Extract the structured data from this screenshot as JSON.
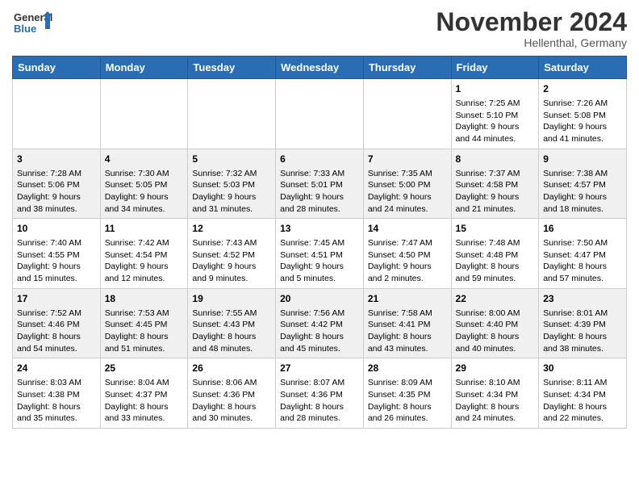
{
  "header": {
    "logo_general": "General",
    "logo_blue": "Blue",
    "month_title": "November 2024",
    "location": "Hellenthal, Germany"
  },
  "weekdays": [
    "Sunday",
    "Monday",
    "Tuesday",
    "Wednesday",
    "Thursday",
    "Friday",
    "Saturday"
  ],
  "weeks": [
    [
      {
        "day": "",
        "sunrise": "",
        "sunset": "",
        "daylight": ""
      },
      {
        "day": "",
        "sunrise": "",
        "sunset": "",
        "daylight": ""
      },
      {
        "day": "",
        "sunrise": "",
        "sunset": "",
        "daylight": ""
      },
      {
        "day": "",
        "sunrise": "",
        "sunset": "",
        "daylight": ""
      },
      {
        "day": "",
        "sunrise": "",
        "sunset": "",
        "daylight": ""
      },
      {
        "day": "1",
        "sunrise": "Sunrise: 7:25 AM",
        "sunset": "Sunset: 5:10 PM",
        "daylight": "Daylight: 9 hours and 44 minutes."
      },
      {
        "day": "2",
        "sunrise": "Sunrise: 7:26 AM",
        "sunset": "Sunset: 5:08 PM",
        "daylight": "Daylight: 9 hours and 41 minutes."
      }
    ],
    [
      {
        "day": "3",
        "sunrise": "Sunrise: 7:28 AM",
        "sunset": "Sunset: 5:06 PM",
        "daylight": "Daylight: 9 hours and 38 minutes."
      },
      {
        "day": "4",
        "sunrise": "Sunrise: 7:30 AM",
        "sunset": "Sunset: 5:05 PM",
        "daylight": "Daylight: 9 hours and 34 minutes."
      },
      {
        "day": "5",
        "sunrise": "Sunrise: 7:32 AM",
        "sunset": "Sunset: 5:03 PM",
        "daylight": "Daylight: 9 hours and 31 minutes."
      },
      {
        "day": "6",
        "sunrise": "Sunrise: 7:33 AM",
        "sunset": "Sunset: 5:01 PM",
        "daylight": "Daylight: 9 hours and 28 minutes."
      },
      {
        "day": "7",
        "sunrise": "Sunrise: 7:35 AM",
        "sunset": "Sunset: 5:00 PM",
        "daylight": "Daylight: 9 hours and 24 minutes."
      },
      {
        "day": "8",
        "sunrise": "Sunrise: 7:37 AM",
        "sunset": "Sunset: 4:58 PM",
        "daylight": "Daylight: 9 hours and 21 minutes."
      },
      {
        "day": "9",
        "sunrise": "Sunrise: 7:38 AM",
        "sunset": "Sunset: 4:57 PM",
        "daylight": "Daylight: 9 hours and 18 minutes."
      }
    ],
    [
      {
        "day": "10",
        "sunrise": "Sunrise: 7:40 AM",
        "sunset": "Sunset: 4:55 PM",
        "daylight": "Daylight: 9 hours and 15 minutes."
      },
      {
        "day": "11",
        "sunrise": "Sunrise: 7:42 AM",
        "sunset": "Sunset: 4:54 PM",
        "daylight": "Daylight: 9 hours and 12 minutes."
      },
      {
        "day": "12",
        "sunrise": "Sunrise: 7:43 AM",
        "sunset": "Sunset: 4:52 PM",
        "daylight": "Daylight: 9 hours and 9 minutes."
      },
      {
        "day": "13",
        "sunrise": "Sunrise: 7:45 AM",
        "sunset": "Sunset: 4:51 PM",
        "daylight": "Daylight: 9 hours and 5 minutes."
      },
      {
        "day": "14",
        "sunrise": "Sunrise: 7:47 AM",
        "sunset": "Sunset: 4:50 PM",
        "daylight": "Daylight: 9 hours and 2 minutes."
      },
      {
        "day": "15",
        "sunrise": "Sunrise: 7:48 AM",
        "sunset": "Sunset: 4:48 PM",
        "daylight": "Daylight: 8 hours and 59 minutes."
      },
      {
        "day": "16",
        "sunrise": "Sunrise: 7:50 AM",
        "sunset": "Sunset: 4:47 PM",
        "daylight": "Daylight: 8 hours and 57 minutes."
      }
    ],
    [
      {
        "day": "17",
        "sunrise": "Sunrise: 7:52 AM",
        "sunset": "Sunset: 4:46 PM",
        "daylight": "Daylight: 8 hours and 54 minutes."
      },
      {
        "day": "18",
        "sunrise": "Sunrise: 7:53 AM",
        "sunset": "Sunset: 4:45 PM",
        "daylight": "Daylight: 8 hours and 51 minutes."
      },
      {
        "day": "19",
        "sunrise": "Sunrise: 7:55 AM",
        "sunset": "Sunset: 4:43 PM",
        "daylight": "Daylight: 8 hours and 48 minutes."
      },
      {
        "day": "20",
        "sunrise": "Sunrise: 7:56 AM",
        "sunset": "Sunset: 4:42 PM",
        "daylight": "Daylight: 8 hours and 45 minutes."
      },
      {
        "day": "21",
        "sunrise": "Sunrise: 7:58 AM",
        "sunset": "Sunset: 4:41 PM",
        "daylight": "Daylight: 8 hours and 43 minutes."
      },
      {
        "day": "22",
        "sunrise": "Sunrise: 8:00 AM",
        "sunset": "Sunset: 4:40 PM",
        "daylight": "Daylight: 8 hours and 40 minutes."
      },
      {
        "day": "23",
        "sunrise": "Sunrise: 8:01 AM",
        "sunset": "Sunset: 4:39 PM",
        "daylight": "Daylight: 8 hours and 38 minutes."
      }
    ],
    [
      {
        "day": "24",
        "sunrise": "Sunrise: 8:03 AM",
        "sunset": "Sunset: 4:38 PM",
        "daylight": "Daylight: 8 hours and 35 minutes."
      },
      {
        "day": "25",
        "sunrise": "Sunrise: 8:04 AM",
        "sunset": "Sunset: 4:37 PM",
        "daylight": "Daylight: 8 hours and 33 minutes."
      },
      {
        "day": "26",
        "sunrise": "Sunrise: 8:06 AM",
        "sunset": "Sunset: 4:36 PM",
        "daylight": "Daylight: 8 hours and 30 minutes."
      },
      {
        "day": "27",
        "sunrise": "Sunrise: 8:07 AM",
        "sunset": "Sunset: 4:36 PM",
        "daylight": "Daylight: 8 hours and 28 minutes."
      },
      {
        "day": "28",
        "sunrise": "Sunrise: 8:09 AM",
        "sunset": "Sunset: 4:35 PM",
        "daylight": "Daylight: 8 hours and 26 minutes."
      },
      {
        "day": "29",
        "sunrise": "Sunrise: 8:10 AM",
        "sunset": "Sunset: 4:34 PM",
        "daylight": "Daylight: 8 hours and 24 minutes."
      },
      {
        "day": "30",
        "sunrise": "Sunrise: 8:11 AM",
        "sunset": "Sunset: 4:34 PM",
        "daylight": "Daylight: 8 hours and 22 minutes."
      }
    ]
  ]
}
